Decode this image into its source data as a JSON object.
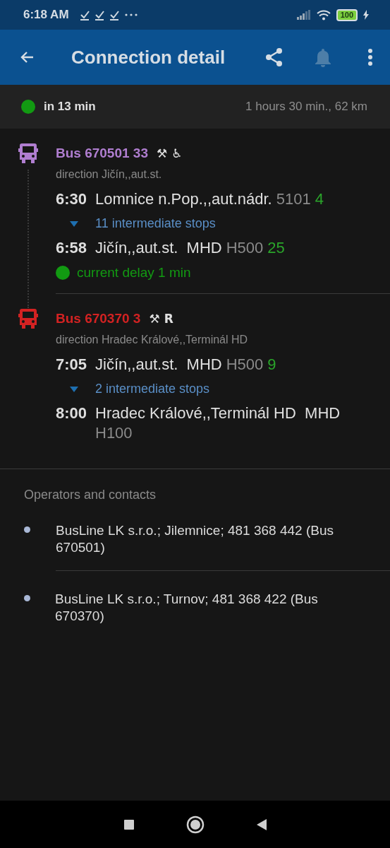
{
  "status_bar": {
    "time": "6:18 AM",
    "battery": "100"
  },
  "toolbar": {
    "title": "Connection detail",
    "actions": [
      {
        "kind": "share",
        "disabled": false
      },
      {
        "kind": "bell",
        "disabled": true
      },
      {
        "kind": "more",
        "disabled": false
      }
    ]
  },
  "summary": {
    "departure": "in 13 min",
    "color": "#129a12",
    "duration": "1 hours 30 min., 62 km"
  },
  "legs": [
    {
      "title": "Bus 670501 33",
      "color": "#b07ed0",
      "features": [
        "⚒",
        "♿"
      ],
      "direction": "direction Jičín,,aut.st.",
      "from": {
        "time": "6:30",
        "name": "Lomnice n.Pop.,,aut.nádr.",
        "code": "5101",
        "track": "4"
      },
      "intermediate": {
        "text": "11 intermediate stops",
        "expanded": false
      },
      "to": {
        "time": "6:58",
        "name": "Jičín,,aut.st.  MHD",
        "code": "H500",
        "track": "25"
      },
      "delay": {
        "text": "current delay 1 min",
        "color": "#129a12"
      }
    },
    {
      "title": "Bus 670370 3",
      "color": "#d32222",
      "features": [
        "⚒",
        "R"
      ],
      "direction": "direction Hradec Králové,,Terminál HD",
      "from": {
        "time": "7:05",
        "name": "Jičín,,aut.st.  MHD",
        "code": "H500",
        "track": "9"
      },
      "intermediate": {
        "text": "2 intermediate stops",
        "expanded": false
      },
      "to": {
        "time": "8:00",
        "name": "Hradec Králové,,Terminál HD  MHD",
        "code": "H100"
      }
    }
  ],
  "operators": {
    "heading": "Operators and contacts",
    "items": [
      "BusLine LK s.r.o.; Jilemnice; 481 368 442 (Bus 670501)",
      "BusLine LK s.r.o.; Turnov; 481 368 422 (Bus 670370)"
    ]
  }
}
